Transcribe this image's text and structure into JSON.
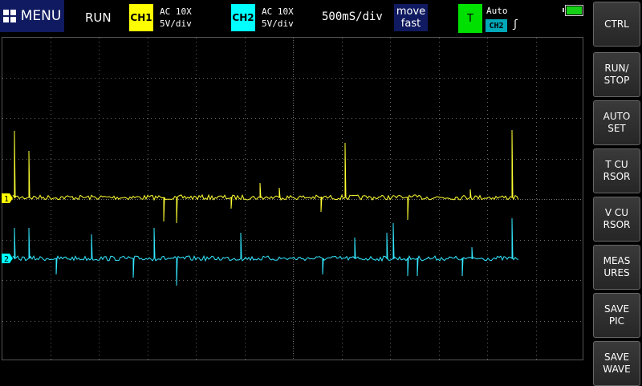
{
  "header": {
    "menu_label": "MENU",
    "run_status": "RUN",
    "ch1": {
      "badge": "CH1",
      "coupling": "AC 10X",
      "scale": "5V/div",
      "color": "#ffff00"
    },
    "ch2": {
      "badge": "CH2",
      "coupling": "AC 10X",
      "scale": "5V/div",
      "color": "#00ffff"
    },
    "timebase": "500mS/div",
    "move": {
      "line1": "move",
      "line2": "fast"
    },
    "trigger": {
      "badge": "T",
      "mode": "Auto",
      "source": "CH2",
      "edge": "ʃ",
      "color": "#00e000"
    },
    "battery_icon": "battery-full-icon"
  },
  "sidebar": {
    "buttons": [
      {
        "label": "CTRL"
      },
      {
        "label": "RUN/\nSTOP"
      },
      {
        "label": "AUTO\nSET"
      },
      {
        "label": "T CU\nRSOR"
      },
      {
        "label": "V CU\nRSOR"
      },
      {
        "label": "MEAS\nURES"
      },
      {
        "label": "SAVE\nPIC"
      },
      {
        "label": "SAVE\nWAVE"
      }
    ]
  },
  "scope": {
    "ch1_marker": "1",
    "ch2_marker": "2"
  }
}
